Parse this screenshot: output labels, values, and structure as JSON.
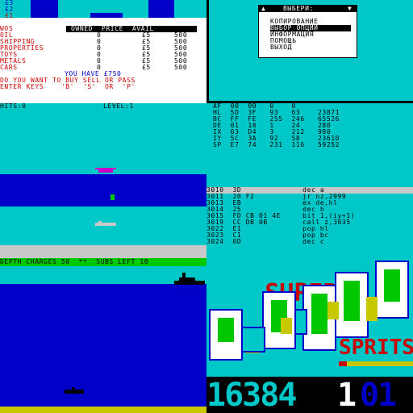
{
  "trading": {
    "money_lines": [
      "£3",
      "£2",
      "£1"
    ],
    "title_code": "WOS",
    "headers": "OWNED  PRICE  AVAIL",
    "rows": [
      {
        "name": "OIL",
        "owned": "0",
        "price": "£5",
        "avail": "500"
      },
      {
        "name": "SHIPPING",
        "owned": "0",
        "price": "£5",
        "avail": "500"
      },
      {
        "name": "PROPERTIES",
        "owned": "0",
        "price": "£5",
        "avail": "500"
      },
      {
        "name": "TOYS",
        "owned": "0",
        "price": "£5",
        "avail": "500"
      },
      {
        "name": "METALS",
        "owned": "0",
        "price": "£5",
        "avail": "500"
      },
      {
        "name": "CARS",
        "owned": "0",
        "price": "£5",
        "avail": "500"
      }
    ],
    "balance": "YOU HAVE £750",
    "question": "DO YOU WANT TO BUY SELL OR PASS",
    "enter_keys": "ENTER KEYS    'B'  'S'  OR  'P'"
  },
  "menu": {
    "title": "ВЫБЕРИ:",
    "items": [
      {
        "label": "КОПИРОВАНИЕ",
        "selected": false
      },
      {
        "label": "ВЫБОР ОПЦИИ",
        "selected": true
      },
      {
        "label": "ИНФОРМАЦИЯ",
        "selected": false
      },
      {
        "label": "ПОМОЩЬ",
        "selected": false
      },
      {
        "label": "ВЫХОД",
        "selected": false
      }
    ]
  },
  "game1": {
    "hits_label": "HITS:0",
    "level_label": "LEVEL:1"
  },
  "registers": [
    "AF  00  00   0    0",
    "HL  5D  3F   93   63    23871",
    "BC  FF  FE   255  246   65526",
    "DE  01  18   1    24    280",
    "IX  03  D4   3    212   980",
    "IY  5C  3A   92   58    23610",
    "SP  E7  74   231  116   59252"
  ],
  "disassembly": [
    "3010  3D              dec a",
    "3011  20 F2           jr nz,2999",
    "3013  EB              ex de,hl",
    "3014  25              dec h",
    "3015  FD CB 01 4E     bit 1,(iy+1)",
    "3019  CC DB 0B        call z,3035",
    "3022  E1              pop hl",
    "3023  C1              pop bc",
    "3024  0D              dec c"
  ],
  "game2": {
    "status": "DEPTH CHARGES 50  **  SUBS LEFT 10"
  },
  "promo": {
    "super": "SUPER",
    "sprits": "SPRITS",
    "number_left": "16384",
    "number_right_a": "1",
    "number_right_b": "01"
  },
  "colors": {
    "cyan": "#00c8c8",
    "blue": "#0000c8",
    "red": "#d00000",
    "green": "#00c800",
    "yellow": "#c8c800",
    "magenta": "#c800c8"
  }
}
